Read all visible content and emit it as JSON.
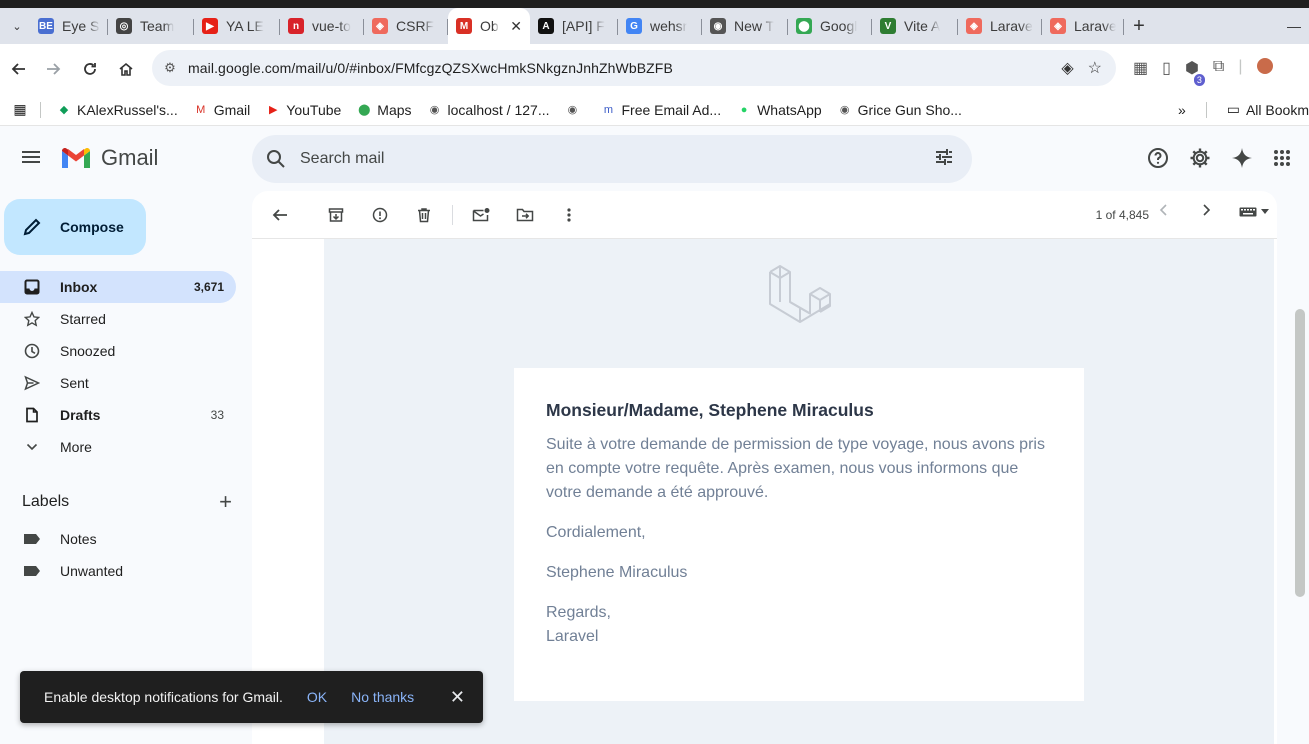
{
  "browser": {
    "tabs": [
      {
        "title": "Eye Sl",
        "icon": "be-icon",
        "color": "#4a6fd1",
        "glyph": "BE"
      },
      {
        "title": "Team",
        "icon": "openai-icon",
        "color": "#444444",
        "glyph": "◎"
      },
      {
        "title": "YA LE",
        "icon": "youtube-icon",
        "color": "#e62117",
        "glyph": "▶"
      },
      {
        "title": "vue-to",
        "icon": "vue-to-icon",
        "color": "#d8232a",
        "glyph": "n"
      },
      {
        "title": "CSRF",
        "icon": "laravel-icon",
        "color": "#ef6a5d",
        "glyph": "◈"
      },
      {
        "title": "Ob",
        "icon": "gmail-icon",
        "color": "#d93025",
        "glyph": "M",
        "active": true
      },
      {
        "title": "[API] F",
        "icon": "api-icon",
        "color": "#111111",
        "glyph": "A"
      },
      {
        "title": "wehsr",
        "icon": "google-icon",
        "color": "#4285f4",
        "glyph": "G"
      },
      {
        "title": "New T",
        "icon": "chrome-icon",
        "color": "#555555",
        "glyph": "◉"
      },
      {
        "title": "Googl",
        "icon": "maps-icon",
        "color": "#34a853",
        "glyph": "⬤"
      },
      {
        "title": "Vite A",
        "icon": "vite-icon",
        "color": "#2e7d32",
        "glyph": "V"
      },
      {
        "title": "Larave",
        "icon": "laravel-icon",
        "color": "#ef6a5d",
        "glyph": "◈"
      },
      {
        "title": "Larave",
        "icon": "laravel-icon",
        "color": "#ef6a5d",
        "glyph": "◈"
      }
    ],
    "url": "mail.google.com/mail/u/0/#inbox/FMfcgzQZSXwcHmkSNkgznJnhZhWbBZFB",
    "ext_badge": "3",
    "bookmarks": [
      {
        "label": "KAlexRussel's...",
        "color": "#0f9d58",
        "glyph": "◆"
      },
      {
        "label": "Gmail",
        "color": "#d93025",
        "glyph": "M"
      },
      {
        "label": "YouTube",
        "color": "#e62117",
        "glyph": "▶"
      },
      {
        "label": "Maps",
        "color": "#34a853",
        "glyph": "⬤"
      },
      {
        "label": "localhost / 127...",
        "color": "#555555",
        "glyph": "◉"
      },
      {
        "label": "",
        "color": "#555555",
        "glyph": "◉"
      },
      {
        "label": "Free Email Ad...",
        "color": "#3a5bc7",
        "glyph": "m"
      },
      {
        "label": "WhatsApp",
        "color": "#25d366",
        "glyph": "●"
      },
      {
        "label": "Grice Gun Sho...",
        "color": "#555555",
        "glyph": "◉"
      }
    ],
    "bookmarks_more": "»",
    "all_bookmarks": "All Bookm"
  },
  "gmail": {
    "brand": "Gmail",
    "search_placeholder": "Search mail",
    "compose": "Compose",
    "nav": [
      {
        "label": "Inbox",
        "count": "3,671",
        "icon": "inbox-icon"
      },
      {
        "label": "Starred",
        "count": "",
        "icon": "star-icon"
      },
      {
        "label": "Snoozed",
        "count": "",
        "icon": "clock-icon"
      },
      {
        "label": "Sent",
        "count": "",
        "icon": "send-icon"
      },
      {
        "label": "Drafts",
        "count": "33",
        "icon": "draft-icon"
      },
      {
        "label": "More",
        "count": "",
        "icon": "chevron-down-icon"
      }
    ],
    "labels_title": "Labels",
    "labels": [
      "Notes",
      "Unwanted"
    ],
    "pager": "1 of 4,845"
  },
  "email": {
    "greeting": "Monsieur/Madame, Stephene Miraculus",
    "body": "Suite à votre demande de permission de type voyage, nous avons pris en compte votre requête. Après examen, nous vous informons que votre demande a été approuvé.",
    "closing": "Cordialement,",
    "sender": "Stephene Miraculus",
    "regards": "Regards,",
    "signature": "Laravel"
  },
  "toast": {
    "message": "Enable desktop notifications for Gmail.",
    "ok": "OK",
    "no_thanks": "No thanks"
  },
  "colors": {
    "accent": "#0b57d0",
    "compose_bg": "#c2e7ff",
    "inbox_active": "#d3e3fd",
    "mail_bg": "#edf2f7"
  }
}
